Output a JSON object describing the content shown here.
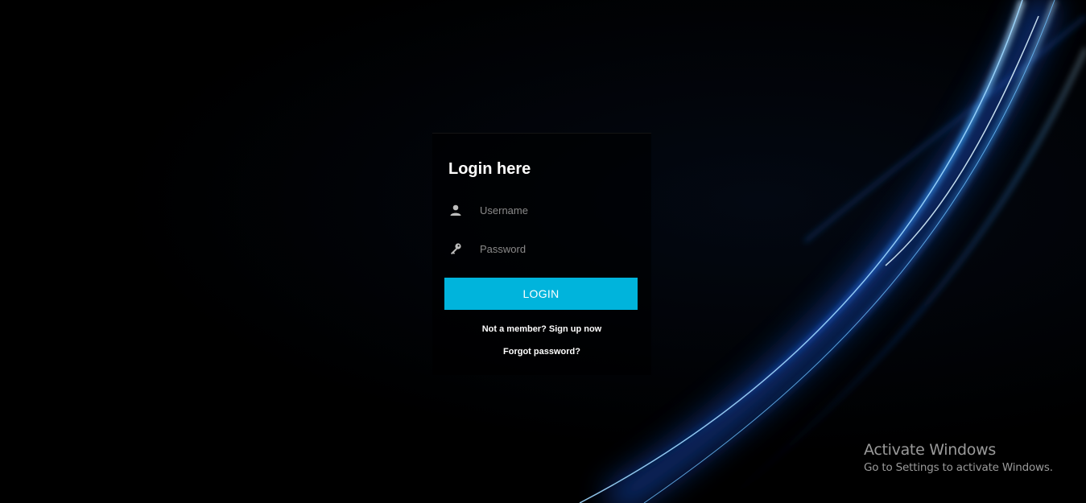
{
  "login": {
    "title": "Login here",
    "username_placeholder": "Username",
    "password_placeholder": "Password",
    "button_label": "LOGIN",
    "signup_link": "Not a member? Sign up now",
    "forgot_link": "Forgot password?"
  },
  "watermark": {
    "title": "Activate Windows",
    "subtitle": "Go to Settings to activate Windows."
  },
  "colors": {
    "accent": "#00b4dc",
    "background": "#000000",
    "text": "#ffffff",
    "light_streak": "#2a7bff"
  },
  "icons": {
    "username": "user-icon",
    "password": "key-icon"
  }
}
